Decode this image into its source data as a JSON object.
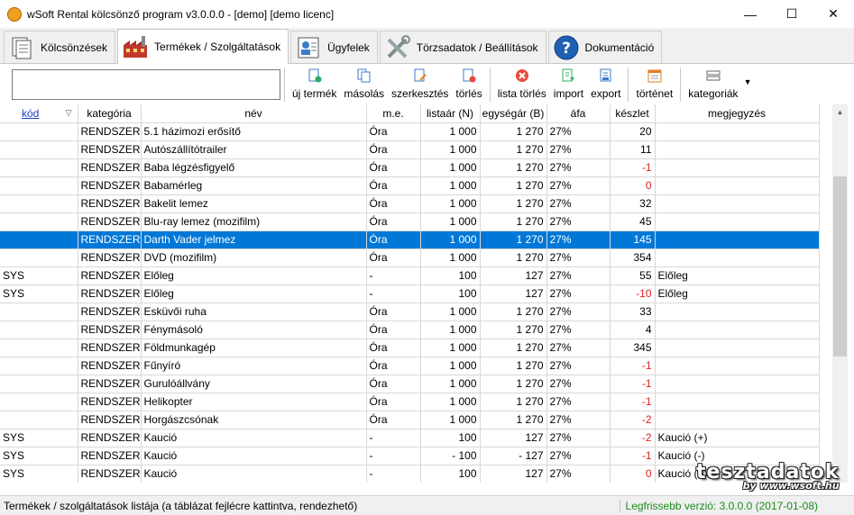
{
  "window": {
    "title": "wSoft Rental kölcsönző program v3.0.0.0 - [demo] [demo licenc]",
    "controls": {
      "minimize": "—",
      "maximize": "☐",
      "close": "✕"
    }
  },
  "tabs": [
    {
      "label": "Kölcsönzések",
      "icon": "documents-icon"
    },
    {
      "label": "Termékek / Szolgáltatások",
      "icon": "factory-icon",
      "active": true
    },
    {
      "label": "Ügyfelek",
      "icon": "contact-card-icon"
    },
    {
      "label": "Törzsadatok / Beállítások",
      "icon": "tools-icon"
    },
    {
      "label": "Dokumentáció",
      "icon": "help-icon"
    }
  ],
  "search": {
    "value": "",
    "placeholder": ""
  },
  "toolbar": {
    "new_product": "új termék",
    "copy": "másolás",
    "edit": "szerkesztés",
    "delete": "törlés",
    "list_delete": "lista törlés",
    "import": "import",
    "export": "export",
    "history": "történet",
    "categories": "kategoriák",
    "dropdown_arrow": "▼"
  },
  "table": {
    "sort_indicator": "▽",
    "headers": {
      "kod": "kód",
      "kategoria": "kategória",
      "nev": "név",
      "me": "m.e.",
      "listaar": "listaár (N)",
      "egysegar": "egységár (B)",
      "afa": "áfa",
      "keszlet": "készlet",
      "megjegyzes": "megjegyzés"
    },
    "rows": [
      {
        "kod": "",
        "kategoria": "RENDSZER",
        "nev": "5.1 házimozi erősítő",
        "me": "Óra",
        "listaar": "1 000",
        "egysegar": "1 270",
        "afa": "27%",
        "keszlet": "20",
        "megjegyzes": "",
        "neg": false,
        "selected": false
      },
      {
        "kod": "",
        "kategoria": "RENDSZER",
        "nev": "Autószállítótrailer",
        "me": "Óra",
        "listaar": "1 000",
        "egysegar": "1 270",
        "afa": "27%",
        "keszlet": "11",
        "megjegyzes": "",
        "neg": false,
        "selected": false
      },
      {
        "kod": "",
        "kategoria": "RENDSZER",
        "nev": "Baba légzésfigyelő",
        "me": "Óra",
        "listaar": "1 000",
        "egysegar": "1 270",
        "afa": "27%",
        "keszlet": "-1",
        "megjegyzes": "",
        "neg": true,
        "selected": false
      },
      {
        "kod": "",
        "kategoria": "RENDSZER",
        "nev": "Babamérleg",
        "me": "Óra",
        "listaar": "1 000",
        "egysegar": "1 270",
        "afa": "27%",
        "keszlet": "0",
        "megjegyzes": "",
        "neg": true,
        "selected": false
      },
      {
        "kod": "",
        "kategoria": "RENDSZER",
        "nev": "Bakelit lemez",
        "me": "Óra",
        "listaar": "1 000",
        "egysegar": "1 270",
        "afa": "27%",
        "keszlet": "32",
        "megjegyzes": "",
        "neg": false,
        "selected": false
      },
      {
        "kod": "",
        "kategoria": "RENDSZER",
        "nev": "Blu-ray lemez (mozifilm)",
        "me": "Óra",
        "listaar": "1 000",
        "egysegar": "1 270",
        "afa": "27%",
        "keszlet": "45",
        "megjegyzes": "",
        "neg": false,
        "selected": false
      },
      {
        "kod": "",
        "kategoria": "RENDSZER",
        "nev": "Darth Vader jelmez",
        "me": "Óra",
        "listaar": "1 000",
        "egysegar": "1 270",
        "afa": "27%",
        "keszlet": "145",
        "megjegyzes": "",
        "neg": false,
        "selected": true
      },
      {
        "kod": "",
        "kategoria": "RENDSZER",
        "nev": "DVD (mozifilm)",
        "me": "Óra",
        "listaar": "1 000",
        "egysegar": "1 270",
        "afa": "27%",
        "keszlet": "354",
        "megjegyzes": "",
        "neg": false,
        "selected": false
      },
      {
        "kod": "SYS",
        "kategoria": "RENDSZER",
        "nev": "Előleg",
        "me": "-",
        "listaar": "100",
        "egysegar": "127",
        "afa": "27%",
        "keszlet": "55",
        "megjegyzes": "Előleg",
        "neg": false,
        "selected": false
      },
      {
        "kod": "SYS",
        "kategoria": "RENDSZER",
        "nev": "Előleg",
        "me": "-",
        "listaar": "100",
        "egysegar": "127",
        "afa": "27%",
        "keszlet": "-10",
        "megjegyzes": "Előleg",
        "neg": true,
        "selected": false
      },
      {
        "kod": "",
        "kategoria": "RENDSZER",
        "nev": "Esküvői ruha",
        "me": "Óra",
        "listaar": "1 000",
        "egysegar": "1 270",
        "afa": "27%",
        "keszlet": "33",
        "megjegyzes": "",
        "neg": false,
        "selected": false
      },
      {
        "kod": "",
        "kategoria": "RENDSZER",
        "nev": "Fénymásoló",
        "me": "Óra",
        "listaar": "1 000",
        "egysegar": "1 270",
        "afa": "27%",
        "keszlet": "4",
        "megjegyzes": "",
        "neg": false,
        "selected": false
      },
      {
        "kod": "",
        "kategoria": "RENDSZER",
        "nev": "Földmunkagép",
        "me": "Óra",
        "listaar": "1 000",
        "egysegar": "1 270",
        "afa": "27%",
        "keszlet": "345",
        "megjegyzes": "",
        "neg": false,
        "selected": false
      },
      {
        "kod": "",
        "kategoria": "RENDSZER",
        "nev": "Fűnyíró",
        "me": "Óra",
        "listaar": "1 000",
        "egysegar": "1 270",
        "afa": "27%",
        "keszlet": "-1",
        "megjegyzes": "",
        "neg": true,
        "selected": false
      },
      {
        "kod": "",
        "kategoria": "RENDSZER",
        "nev": "Gurulóállvány",
        "me": "Óra",
        "listaar": "1 000",
        "egysegar": "1 270",
        "afa": "27%",
        "keszlet": "-1",
        "megjegyzes": "",
        "neg": true,
        "selected": false
      },
      {
        "kod": "",
        "kategoria": "RENDSZER",
        "nev": "Helikopter",
        "me": "Óra",
        "listaar": "1 000",
        "egysegar": "1 270",
        "afa": "27%",
        "keszlet": "-1",
        "megjegyzes": "",
        "neg": true,
        "selected": false
      },
      {
        "kod": "",
        "kategoria": "RENDSZER",
        "nev": "Horgászcsónak",
        "me": "Óra",
        "listaar": "1 000",
        "egysegar": "1 270",
        "afa": "27%",
        "keszlet": "-2",
        "megjegyzes": "",
        "neg": true,
        "selected": false
      },
      {
        "kod": "SYS",
        "kategoria": "RENDSZER",
        "nev": "Kaució",
        "me": "-",
        "listaar": "100",
        "egysegar": "127",
        "afa": "27%",
        "keszlet": "-2",
        "megjegyzes": "Kaució (+)",
        "neg": true,
        "selected": false
      },
      {
        "kod": "SYS",
        "kategoria": "RENDSZER",
        "nev": "Kaució",
        "me": "-",
        "listaar": "- 100",
        "egysegar": "- 127",
        "afa": "27%",
        "keszlet": "-1",
        "megjegyzes": "Kaució (-)",
        "neg": true,
        "selected": false
      },
      {
        "kod": "SYS",
        "kategoria": "RENDSZER",
        "nev": "Kaució",
        "me": "-",
        "listaar": "100",
        "egysegar": "127",
        "afa": "27%",
        "keszlet": "0",
        "megjegyzes": "Kaució (+)",
        "neg": true,
        "selected": false
      }
    ]
  },
  "status": {
    "left": "Termékek / szolgáltatások listája (a táblázat fejlécre kattintva, rendezhető)",
    "right": "Legfrissebb verzió: 3.0.0.0 (2017-01-08)"
  },
  "watermark": {
    "big": "tesztadatok",
    "small": "by www.wsoft.hu"
  },
  "colors": {
    "selection": "#0078d7",
    "negative": "#e02020",
    "link": "#1f3fc8",
    "version": "#1a8c1a"
  }
}
